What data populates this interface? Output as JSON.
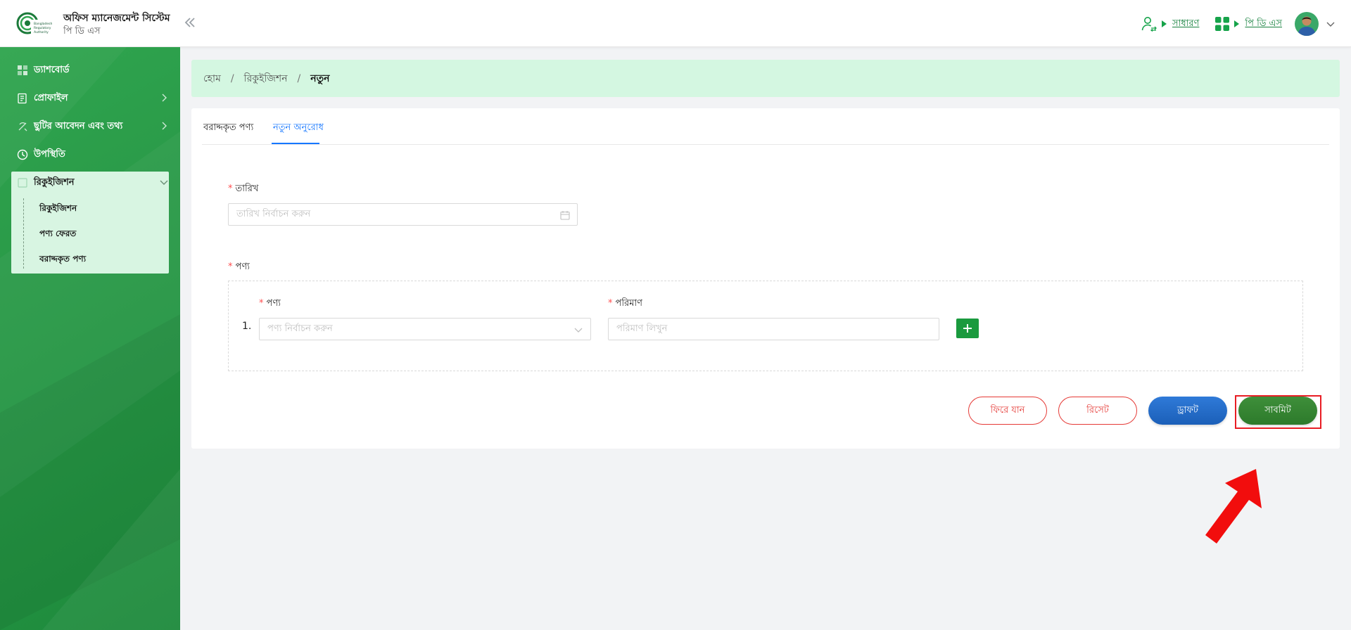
{
  "header": {
    "app_title": "অফিস ম্যানেজমেন্ট সিস্টেম",
    "app_subtitle": "পি ডি এস",
    "logo_text": "Bangladesh Regulatory Authority",
    "role_label": "সাধারণ",
    "module_label": "পি ডি এস",
    "collapse_icon": "double-chevron-left-icon"
  },
  "sidebar": {
    "items": [
      {
        "label": "ড্যাশবোর্ড",
        "icon": "dashboard-icon"
      },
      {
        "label": "প্রোফাইল",
        "icon": "profile-icon",
        "has_children": true
      },
      {
        "label": "ছুটির আবেদন এবং তথ্য",
        "icon": "leave-icon",
        "has_children": true
      },
      {
        "label": "উপস্থিতি",
        "icon": "clock-icon"
      },
      {
        "label": "রিকুইজিশন",
        "icon": "requisition-icon",
        "expanded": true
      }
    ],
    "subitems": [
      "রিকুইজিশন",
      "পণ্য ফেরত",
      "বরাদ্দকৃত পণ্য"
    ]
  },
  "breadcrumb": {
    "home": "হোম",
    "section": "রিকুইজিশন",
    "current": "নতুন"
  },
  "tabs": [
    {
      "label": "বরাদ্দকৃত পণ্য",
      "active": false
    },
    {
      "label": "নতুন অনুরোধ",
      "active": true
    }
  ],
  "form": {
    "date_label": "তারিখ",
    "date_placeholder": "তারিখ নির্বাচন করুন",
    "product_section_label": "পণ্য",
    "rows": [
      {
        "number": "1.",
        "product_label": "পণ্য",
        "product_placeholder": "পণ্য নির্বাচন করুন",
        "quantity_label": "পরিমাণ",
        "quantity_placeholder": "পরিমাণ লিখুন"
      }
    ],
    "required_mark": "*"
  },
  "actions": {
    "back": "ফিরে যান",
    "reset": "রিসেট",
    "draft": "ড্রাফট",
    "submit": "সাবমিট"
  },
  "colors": {
    "sidebar": "#2a9a48",
    "breadcrumb_bg": "#d4f7e1",
    "accent_blue": "#1677ff",
    "danger": "#e53935",
    "submit": "#2d7a2b",
    "highlight": "#e81d24"
  }
}
